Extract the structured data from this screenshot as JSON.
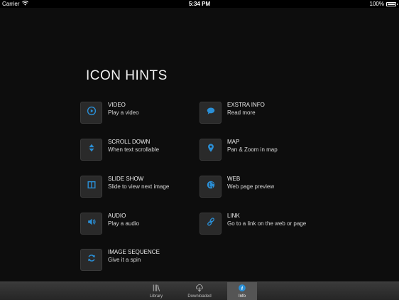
{
  "status_bar": {
    "carrier": "Carrier",
    "time": "5:34 PM",
    "battery_text": "100%",
    "battery_level": 1.0
  },
  "page": {
    "title": "ICON HINTS"
  },
  "hints": [
    {
      "title": "VIDEO",
      "desc": "Play a video",
      "icon": "play-circle-icon"
    },
    {
      "title": "EXSTRA INFO",
      "desc": "Read more",
      "icon": "speech-bubble-icon"
    },
    {
      "title": "SCROLL DOWN",
      "desc": "When text scrollable",
      "icon": "scroll-arrows-icon"
    },
    {
      "title": "MAP",
      "desc": "Pan & Zoom in map",
      "icon": "map-pin-icon"
    },
    {
      "title": "SLIDE SHOW",
      "desc": "Slide to view next image",
      "icon": "slideshow-icon"
    },
    {
      "title": "WEB",
      "desc": "Web page preview",
      "icon": "globe-icon"
    },
    {
      "title": "AUDIO",
      "desc": "Play a audio",
      "icon": "speaker-icon"
    },
    {
      "title": "LINK",
      "desc": "Go to a link on the web or page",
      "icon": "link-icon"
    },
    {
      "title": "IMAGE SEQUENCE",
      "desc": "Give it a spin",
      "icon": "refresh-icon"
    }
  ],
  "tabbar": {
    "tabs": [
      {
        "label": "Library",
        "icon": "library-icon"
      },
      {
        "label": "Downloaded",
        "icon": "cloud-download-icon"
      },
      {
        "label": "Info",
        "icon": "info-icon",
        "active": true
      }
    ]
  },
  "colors": {
    "accent": "#2a8fd6",
    "background": "#0d0d0d",
    "icon_box": "#2a2a2a"
  }
}
